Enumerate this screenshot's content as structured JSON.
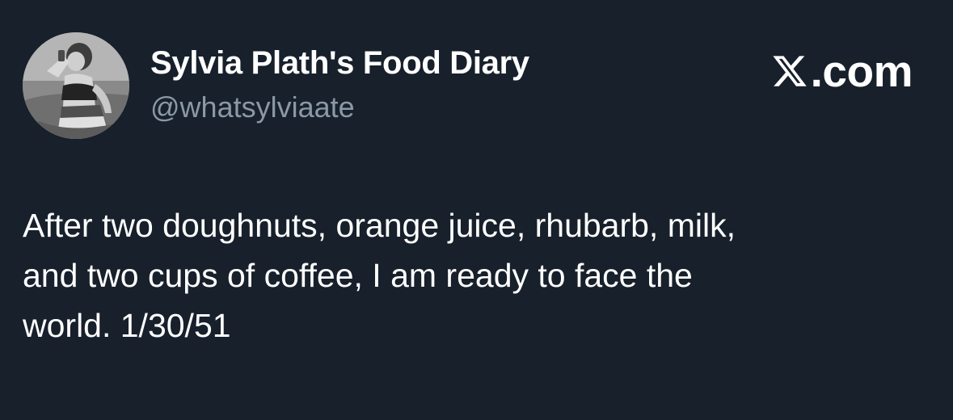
{
  "brand": {
    "icon": "x-logo-icon",
    "text": ".com"
  },
  "author": {
    "display_name": "Sylvia Plath's Food Diary",
    "handle": "@whatsylviaate"
  },
  "tweet": {
    "lines": [
      "After two doughnuts, orange juice, rhubarb, milk,",
      "and two cups of coffee, I am ready to face the",
      "world. 1/30/51"
    ]
  },
  "colors": {
    "background": "#17202b",
    "primary_text": "#ffffff",
    "secondary_text": "#8b98a5"
  }
}
